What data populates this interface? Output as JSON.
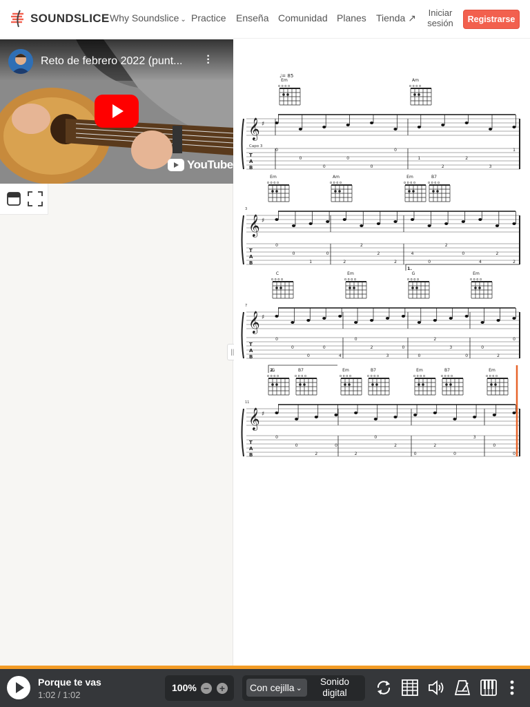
{
  "nav": {
    "logo_text": "SOUNDSLICE",
    "links": [
      "Why Soundslice",
      "Practice",
      "Enseña",
      "Comunidad",
      "Planes",
      "Tienda ↗"
    ],
    "login_line1": "Iniciar",
    "login_line2": "sesión",
    "signup_label": "Registrarse"
  },
  "video": {
    "title": "Reto de febrero 2022 (punt...",
    "youtube_label": "YouTube"
  },
  "score": {
    "tempo": "♩= 85",
    "capo": "Capo 3",
    "chords_line1": [
      "Em",
      "Am"
    ],
    "chords_line2": [
      "Em",
      "Am",
      "Em",
      "B7"
    ],
    "chords_line3": [
      "C",
      "Em",
      "G",
      "Em"
    ],
    "chords_line4": [
      "G",
      "B7",
      "Em",
      "B7",
      "Em",
      "B7",
      "Em"
    ],
    "measure_numbers": [
      "3",
      "7",
      "11"
    ],
    "ending1": "1.",
    "ending2": "2.",
    "tab_line1": [
      "0",
      "0",
      "0",
      "0",
      "0",
      "0",
      "1",
      "2",
      "2",
      "3",
      "1"
    ],
    "tab_line2": [
      "0",
      "0",
      "1",
      "0",
      "2",
      "2",
      "2",
      "2",
      "4",
      "0",
      "2",
      "0",
      "4",
      "2",
      "2"
    ],
    "tab_line3": [
      "0",
      "0",
      "0",
      "0",
      "4",
      "0",
      "2",
      "3",
      "0",
      "0",
      "2",
      "3",
      "0",
      "0",
      "2",
      "0"
    ],
    "tab_line4": [
      "0",
      "0",
      "2",
      "0",
      "2",
      "0",
      "2",
      "0",
      "2",
      "0",
      "3",
      "0",
      "0"
    ]
  },
  "player": {
    "title": "Porque te vas",
    "time": "1:02 / 1:02",
    "zoom": "100%",
    "capo_option": "Con cejilla",
    "sound_line1": "Sonido",
    "sound_line2": "digital"
  },
  "colors": {
    "accent": "#f2604e",
    "player_bg": "#35373a",
    "progress": "#f39c25",
    "playhead": "#e8642a"
  }
}
